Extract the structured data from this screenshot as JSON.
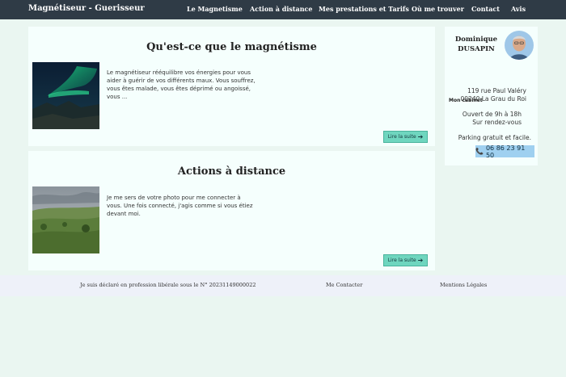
{
  "header": {
    "brand": "Magnétiseur - Guerisseur",
    "nav": [
      "Le Magnetisme",
      "Action à distance",
      "Mes prestations et Tarifs",
      "Où me trouver",
      "Contact",
      "Avis"
    ]
  },
  "articles": [
    {
      "title": "Qu'est-ce que le magnétisme",
      "excerpt": "Le magnétiseur rééquilibre vos énergies pour vous aider à guérir de vos différents maux. Vous souffrez, vous êtes malade, vous êtes déprimé ou angoissé, vous ...",
      "button": "Lire la suite",
      "image_icon": "aurora-image"
    },
    {
      "title": "Actions à distance",
      "excerpt": "Je me sers de votre photo pour me connecter à vous. Une fois connecté, j'agis comme si vous étiez devant moi.",
      "button": "Lire la suite",
      "image_icon": "landscape-image"
    }
  ],
  "sidebar": {
    "name_line1": "Dominique",
    "name_line2": "DUSAPIN",
    "cabinet_heading": "Mon cabinet",
    "address_line1": "119 rue Paul Valéry",
    "address_line2": "00240 La Grau du Roi",
    "hours_line1": "Ouvert de 9h à 18h",
    "hours_line2": "Sur rendez-vous",
    "parking": "Parking gratuit et facile.",
    "phone": "06 86 23 91 50",
    "phone_icon": "phone-icon"
  },
  "footer": {
    "legal": "Je suis déclaré en profession libérale sous le N° 20231149000022",
    "contact": "Me Contacter",
    "mentions": "Mentions Légales"
  },
  "colors": {
    "topbar": "#2f3b46",
    "page_bg": "#eaf6f1",
    "card_bg": "#f5fffd",
    "button": "#6fd6bf",
    "phone_button": "#9fd0f0",
    "footer_bg": "#eef1f9"
  }
}
